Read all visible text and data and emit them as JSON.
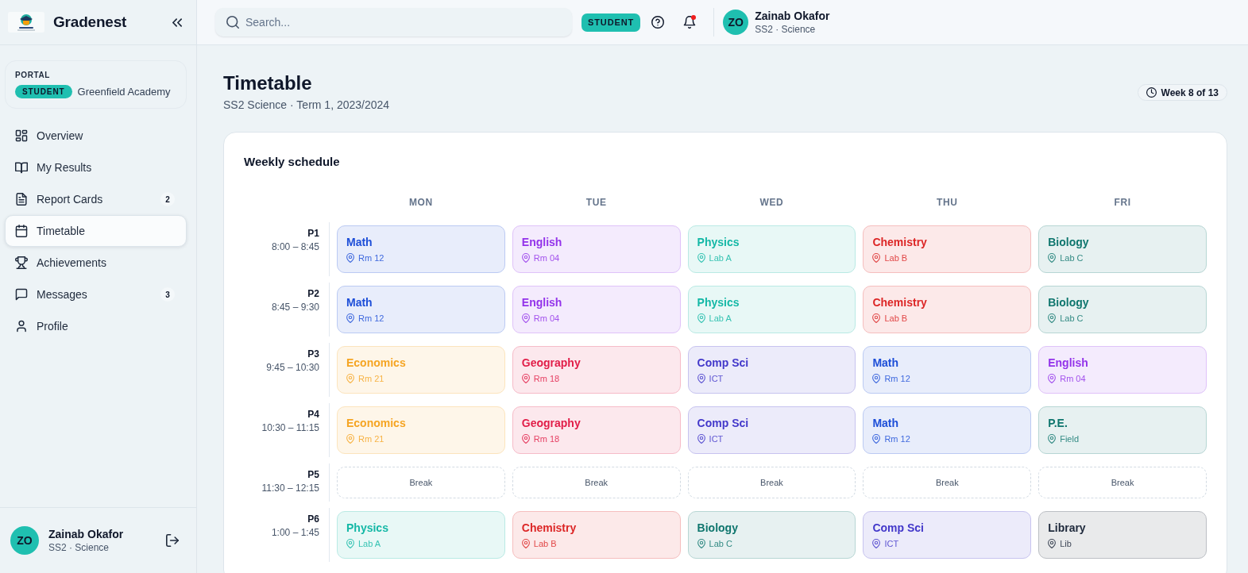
{
  "sidebar": {
    "brand": "Gradenest",
    "portal": {
      "label": "PORTAL",
      "role": "STUDENT",
      "school": "Greenfield Academy"
    },
    "nav": [
      {
        "label": "Overview",
        "selected": false
      },
      {
        "label": "My Results",
        "selected": false
      },
      {
        "label": "Report Cards",
        "badge": "2",
        "selected": false
      },
      {
        "label": "Timetable",
        "selected": true
      },
      {
        "label": "Achievements",
        "selected": false
      },
      {
        "label": "Messages",
        "badge": "3",
        "selected": false
      },
      {
        "label": "Profile",
        "selected": false
      }
    ],
    "user": {
      "initials": "ZO",
      "name": "Zainab Okafor",
      "detail": "SS2 · Science"
    }
  },
  "topbar": {
    "search": {
      "placeholder": "Search..."
    },
    "role": "STUDENT",
    "notifications": {
      "unread": true
    },
    "user": {
      "initials": "ZO",
      "name": "Zainab Okafor",
      "detail": "SS2 · Science"
    }
  },
  "page": {
    "title": "Timetable",
    "subtitle": "SS2 Science · Term 1, 2023/2024",
    "week": "Week 8 of 13"
  },
  "schedule": {
    "title": "Weekly schedule",
    "days": [
      "MON",
      "TUE",
      "WED",
      "THU",
      "FRI"
    ],
    "periods": [
      {
        "label": "P1",
        "time": "8:00 – 8:45",
        "cells": [
          {
            "kind": "class",
            "subject": "Math",
            "room": "Rm 12",
            "color": "#1d4ed8"
          },
          {
            "kind": "class",
            "subject": "English",
            "room": "Rm 04",
            "color": "#9333ea"
          },
          {
            "kind": "class",
            "subject": "Physics",
            "room": "Lab A",
            "color": "#14b8a6"
          },
          {
            "kind": "class",
            "subject": "Chemistry",
            "room": "Lab B",
            "color": "#dc2626"
          },
          {
            "kind": "class",
            "subject": "Biology",
            "room": "Lab C",
            "color": "#0f766e"
          }
        ]
      },
      {
        "label": "P2",
        "time": "8:45 – 9:30",
        "cells": [
          {
            "kind": "class",
            "subject": "Math",
            "room": "Rm 12",
            "color": "#1d4ed8"
          },
          {
            "kind": "class",
            "subject": "English",
            "room": "Rm 04",
            "color": "#9333ea"
          },
          {
            "kind": "class",
            "subject": "Physics",
            "room": "Lab A",
            "color": "#14b8a6"
          },
          {
            "kind": "class",
            "subject": "Chemistry",
            "room": "Lab B",
            "color": "#dc2626"
          },
          {
            "kind": "class",
            "subject": "Biology",
            "room": "Lab C",
            "color": "#0f766e"
          }
        ]
      },
      {
        "label": "P3",
        "time": "9:45 – 10:30",
        "cells": [
          {
            "kind": "class",
            "subject": "Economics",
            "room": "Rm 21",
            "color": "#f5a524"
          },
          {
            "kind": "class",
            "subject": "Geography",
            "room": "Rm 18",
            "color": "#e11d48"
          },
          {
            "kind": "class",
            "subject": "Comp Sci",
            "room": "ICT",
            "color": "#4338ca"
          },
          {
            "kind": "class",
            "subject": "Math",
            "room": "Rm 12",
            "color": "#1d4ed8"
          },
          {
            "kind": "class",
            "subject": "English",
            "room": "Rm 04",
            "color": "#9333ea"
          }
        ]
      },
      {
        "label": "P4",
        "time": "10:30 – 11:15",
        "cells": [
          {
            "kind": "class",
            "subject": "Economics",
            "room": "Rm 21",
            "color": "#f5a524"
          },
          {
            "kind": "class",
            "subject": "Geography",
            "room": "Rm 18",
            "color": "#e11d48"
          },
          {
            "kind": "class",
            "subject": "Comp Sci",
            "room": "ICT",
            "color": "#4338ca"
          },
          {
            "kind": "class",
            "subject": "Math",
            "room": "Rm 12",
            "color": "#1d4ed8"
          },
          {
            "kind": "class",
            "subject": "P.E.",
            "room": "Field",
            "color": "#0f766e"
          }
        ]
      },
      {
        "label": "P5",
        "time": "11:30 – 12:15",
        "cells": [
          {
            "kind": "break",
            "label": "Break"
          },
          {
            "kind": "break",
            "label": "Break"
          },
          {
            "kind": "break",
            "label": "Break"
          },
          {
            "kind": "break",
            "label": "Break"
          },
          {
            "kind": "break",
            "label": "Break"
          }
        ]
      },
      {
        "label": "P6",
        "time": "1:00 – 1:45",
        "cells": [
          {
            "kind": "class",
            "subject": "Physics",
            "room": "Lab A",
            "color": "#14b8a6"
          },
          {
            "kind": "class",
            "subject": "Chemistry",
            "room": "Lab B",
            "color": "#dc2626"
          },
          {
            "kind": "class",
            "subject": "Biology",
            "room": "Lab C",
            "color": "#0f766e"
          },
          {
            "kind": "class",
            "subject": "Comp Sci",
            "room": "ICT",
            "color": "#4338ca"
          },
          {
            "kind": "class",
            "subject": "Library",
            "room": "Lib",
            "color": "#1e293b"
          }
        ]
      }
    ]
  }
}
